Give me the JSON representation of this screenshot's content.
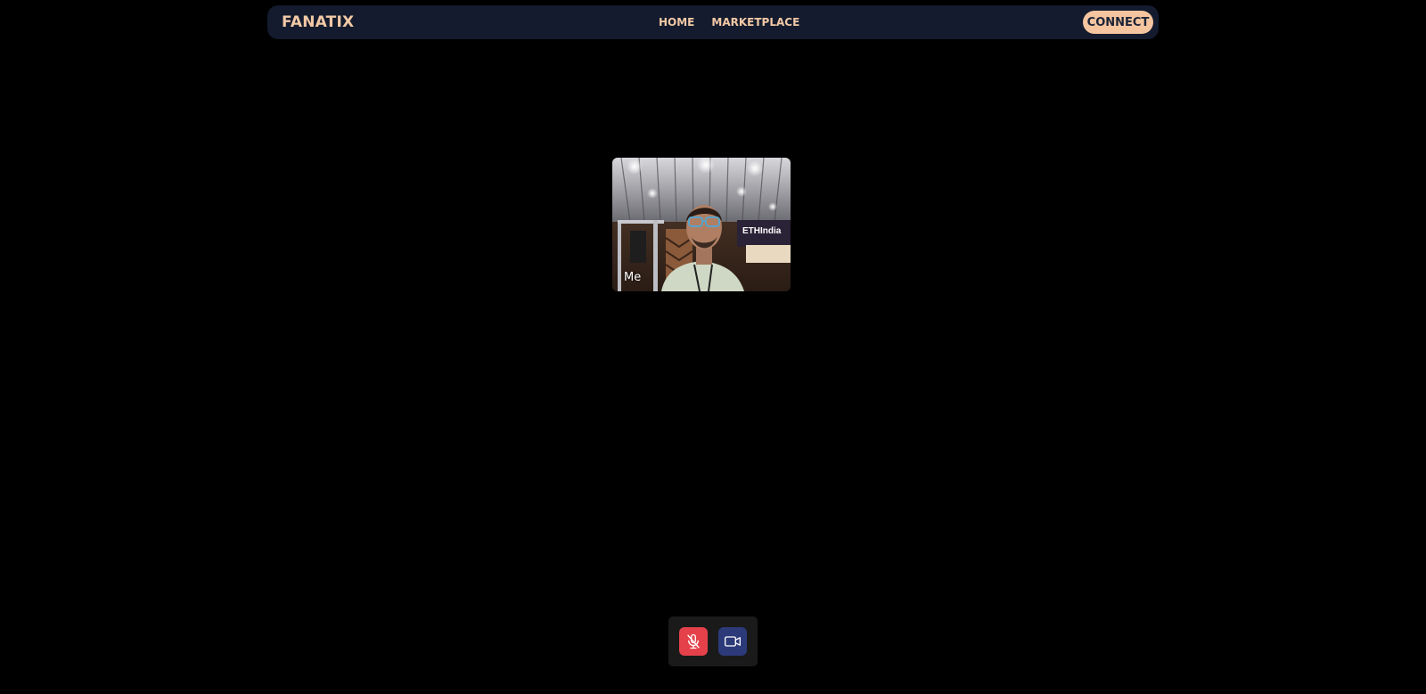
{
  "navbar": {
    "brand": "FANATIX",
    "links": [
      {
        "label": "HOME"
      },
      {
        "label": "MARKETPLACE"
      }
    ],
    "connect_label": "CONNECT"
  },
  "video": {
    "participant_label": "Me",
    "backdrop_text": "ETHIndia"
  },
  "controls": {
    "mic_icon": "mic-off-icon",
    "camera_icon": "video-camera-icon"
  },
  "colors": {
    "background": "#000000",
    "navbar_bg": "#141b2e",
    "accent": "#f5c5a0",
    "mic_muted": "#e5414b",
    "camera_active": "#2c3a7a"
  }
}
